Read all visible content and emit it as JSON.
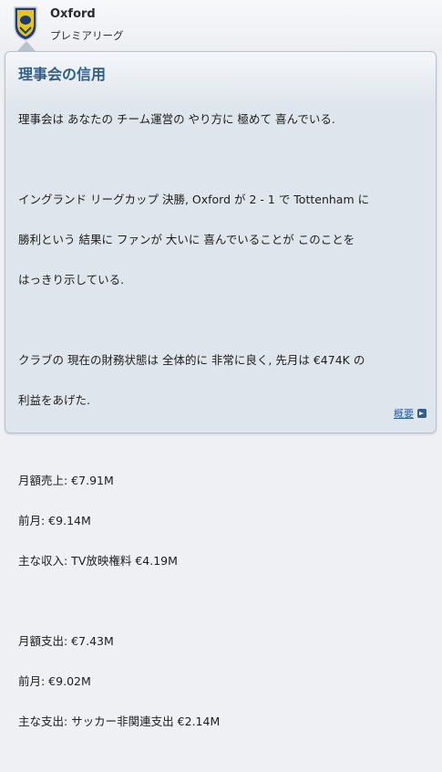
{
  "header": {
    "club_name": "Oxford",
    "league": "プレミアリーグ"
  },
  "panel": {
    "title": "理事会の信用",
    "paragraphs": [
      [
        "理事会は あなたの チーム運営の やり方に 極めて 喜んでいる."
      ],
      [
        "イングランド リーグカップ 決勝, Oxford が 2 - 1 で Tottenham に",
        "勝利という 結果に ファンが 大いに 喜んでいることが このことを",
        "はっきり示している."
      ],
      [
        "クラブの 現在の財務状態は 全体的に 非常に良く, 先月は €474K の",
        "利益をあげた."
      ],
      [
        "月額売上: €7.91M",
        "前月: €9.14M",
        "主な収入: TV放映権料 €4.19M"
      ],
      [
        "月額支出: €7.43M",
        "前月: €9.02M",
        "主な支出: サッカー非関連支出 €2.14M"
      ]
    ],
    "overview_link": "概要"
  },
  "icons": {
    "crest": "club-crest-icon",
    "overview_arrow": "arrow-right-icon"
  },
  "colors": {
    "title": "#2d5e90",
    "panel_border": "#b9c3cf",
    "crest_blue": "#1d3a7a",
    "crest_gold": "#e6c619"
  }
}
